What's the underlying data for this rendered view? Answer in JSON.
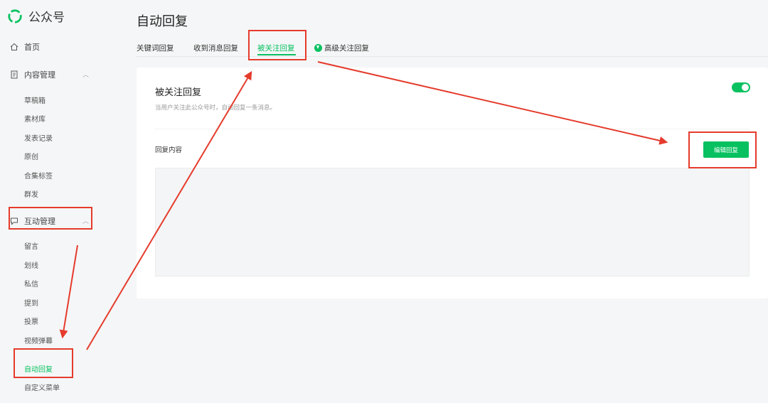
{
  "brand": {
    "name": "公众号"
  },
  "sidebar": {
    "home": "首页",
    "content_mgmt": {
      "label": "内容管理",
      "items": [
        "草稿箱",
        "素材库",
        "发表记录",
        "原创",
        "合集标签",
        "群发"
      ]
    },
    "interaction_mgmt": {
      "label": "互动管理",
      "items": [
        "留言",
        "划线",
        "私信",
        "提到",
        "投票",
        "视频弹幕",
        "自动回复",
        "自定义菜单"
      ]
    }
  },
  "main": {
    "title": "自动回复",
    "tabs": [
      "关键词回复",
      "收到消息回复",
      "被关注回复",
      "高级关注回复"
    ],
    "active_tab": "被关注回复",
    "card": {
      "title": "被关注回复",
      "description": "当用户关注此公众号时，自动回复一条消息。",
      "toggle_on": true,
      "reply_label": "回复内容",
      "edit_button": "编辑回复"
    }
  },
  "colors": {
    "accent": "#07c160",
    "annotation": "#e53b2c"
  }
}
